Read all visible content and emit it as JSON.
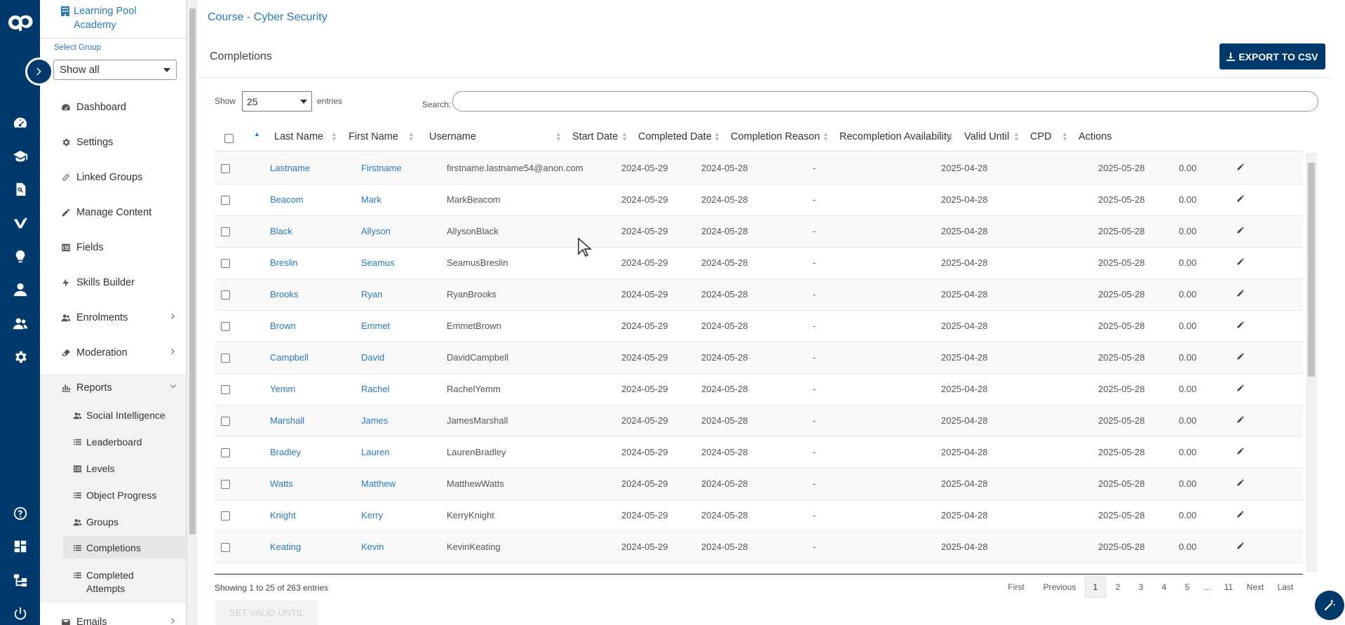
{
  "sidebar": {
    "org_name": "Learning Pool Academy",
    "group_label": "Select Group",
    "group_value": "Show all",
    "items": [
      {
        "label": "Dashboard"
      },
      {
        "label": "Settings"
      },
      {
        "label": "Linked Groups"
      },
      {
        "label": "Manage Content"
      },
      {
        "label": "Fields"
      },
      {
        "label": "Skills Builder"
      },
      {
        "label": "Enrolments"
      },
      {
        "label": "Moderation"
      },
      {
        "label": "Reports"
      },
      {
        "label": "Emails"
      }
    ],
    "report_items": [
      {
        "label": "Social Intelligence"
      },
      {
        "label": "Leaderboard"
      },
      {
        "label": "Levels"
      },
      {
        "label": "Object Progress"
      },
      {
        "label": "Groups"
      },
      {
        "label": "Completions"
      },
      {
        "label": "Completed Attempts"
      }
    ]
  },
  "breadcrumb": "Course - Cyber Security",
  "page_title": "Completions",
  "export_label": "EXPORT TO CSV",
  "controls": {
    "show_label": "Show",
    "show_value": "25",
    "entries_label": "entries",
    "search_label": "Search:",
    "search_value": ""
  },
  "columns": [
    "Last Name",
    "First Name",
    "Username",
    "Start Date",
    "Completed Date",
    "Completion Reason",
    "Recompletion Availability",
    "Valid Until",
    "CPD",
    "Actions"
  ],
  "rows": [
    {
      "last": "Lastname",
      "first": "Firstname",
      "user": "firstname.lastname54@anon.com",
      "start": "2024-05-29",
      "completed": "2024-05-28",
      "reason": "-",
      "recompletion": "2025-04-28",
      "valid": "2025-05-28",
      "cpd": "0.00"
    },
    {
      "last": "Beacom",
      "first": "Mark",
      "user": "MarkBeacom",
      "start": "2024-05-29",
      "completed": "2024-05-28",
      "reason": "-",
      "recompletion": "2025-04-28",
      "valid": "2025-05-28",
      "cpd": "0.00"
    },
    {
      "last": "Black",
      "first": "Allyson",
      "user": "AllysonBlack",
      "start": "2024-05-29",
      "completed": "2024-05-28",
      "reason": "-",
      "recompletion": "2025-04-28",
      "valid": "2025-05-28",
      "cpd": "0.00"
    },
    {
      "last": "Breslin",
      "first": "Seamus",
      "user": "SeamusBreslin",
      "start": "2024-05-29",
      "completed": "2024-05-28",
      "reason": "-",
      "recompletion": "2025-04-28",
      "valid": "2025-05-28",
      "cpd": "0.00"
    },
    {
      "last": "Brooks",
      "first": "Ryan",
      "user": "RyanBrooks",
      "start": "2024-05-29",
      "completed": "2024-05-28",
      "reason": "-",
      "recompletion": "2025-04-28",
      "valid": "2025-05-28",
      "cpd": "0.00"
    },
    {
      "last": "Brown",
      "first": "Emmet",
      "user": "EmmetBrown",
      "start": "2024-05-29",
      "completed": "2024-05-28",
      "reason": "-",
      "recompletion": "2025-04-28",
      "valid": "2025-05-28",
      "cpd": "0.00"
    },
    {
      "last": "Campbell",
      "first": "David",
      "user": "DavidCampbell",
      "start": "2024-05-29",
      "completed": "2024-05-28",
      "reason": "-",
      "recompletion": "2025-04-28",
      "valid": "2025-05-28",
      "cpd": "0.00"
    },
    {
      "last": "Yemm",
      "first": "Rachel",
      "user": "RachelYemm",
      "start": "2024-05-29",
      "completed": "2024-05-28",
      "reason": "-",
      "recompletion": "2025-04-28",
      "valid": "2025-05-28",
      "cpd": "0.00"
    },
    {
      "last": "Marshall",
      "first": "James",
      "user": "JamesMarshall",
      "start": "2024-05-29",
      "completed": "2024-05-28",
      "reason": "-",
      "recompletion": "2025-04-28",
      "valid": "2025-05-28",
      "cpd": "0.00"
    },
    {
      "last": "Bradley",
      "first": "Lauren",
      "user": "LaurenBradley",
      "start": "2024-05-29",
      "completed": "2024-05-28",
      "reason": "-",
      "recompletion": "2025-04-28",
      "valid": "2025-05-28",
      "cpd": "0.00"
    },
    {
      "last": "Watts",
      "first": "Matthew",
      "user": "MatthewWatts",
      "start": "2024-05-29",
      "completed": "2024-05-28",
      "reason": "-",
      "recompletion": "2025-04-28",
      "valid": "2025-05-28",
      "cpd": "0.00"
    },
    {
      "last": "Knight",
      "first": "Kerry",
      "user": "KerryKnight",
      "start": "2024-05-29",
      "completed": "2024-05-28",
      "reason": "-",
      "recompletion": "2025-04-28",
      "valid": "2025-05-28",
      "cpd": "0.00"
    },
    {
      "last": "Keating",
      "first": "Kevin",
      "user": "KevinKeating",
      "start": "2024-05-29",
      "completed": "2024-05-28",
      "reason": "-",
      "recompletion": "2025-04-28",
      "valid": "2025-05-28",
      "cpd": "0.00"
    }
  ],
  "footer": {
    "info": "Showing 1 to 25 of 263 entries",
    "pager": [
      "First",
      "Previous",
      "1",
      "2",
      "3",
      "4",
      "5",
      "...",
      "11",
      "Next",
      "Last"
    ],
    "current_page": "1",
    "set_valid_label": "SET VALID UNTIL"
  },
  "colors": {
    "brand": "#003a6c",
    "link": "#2a7ab8"
  }
}
